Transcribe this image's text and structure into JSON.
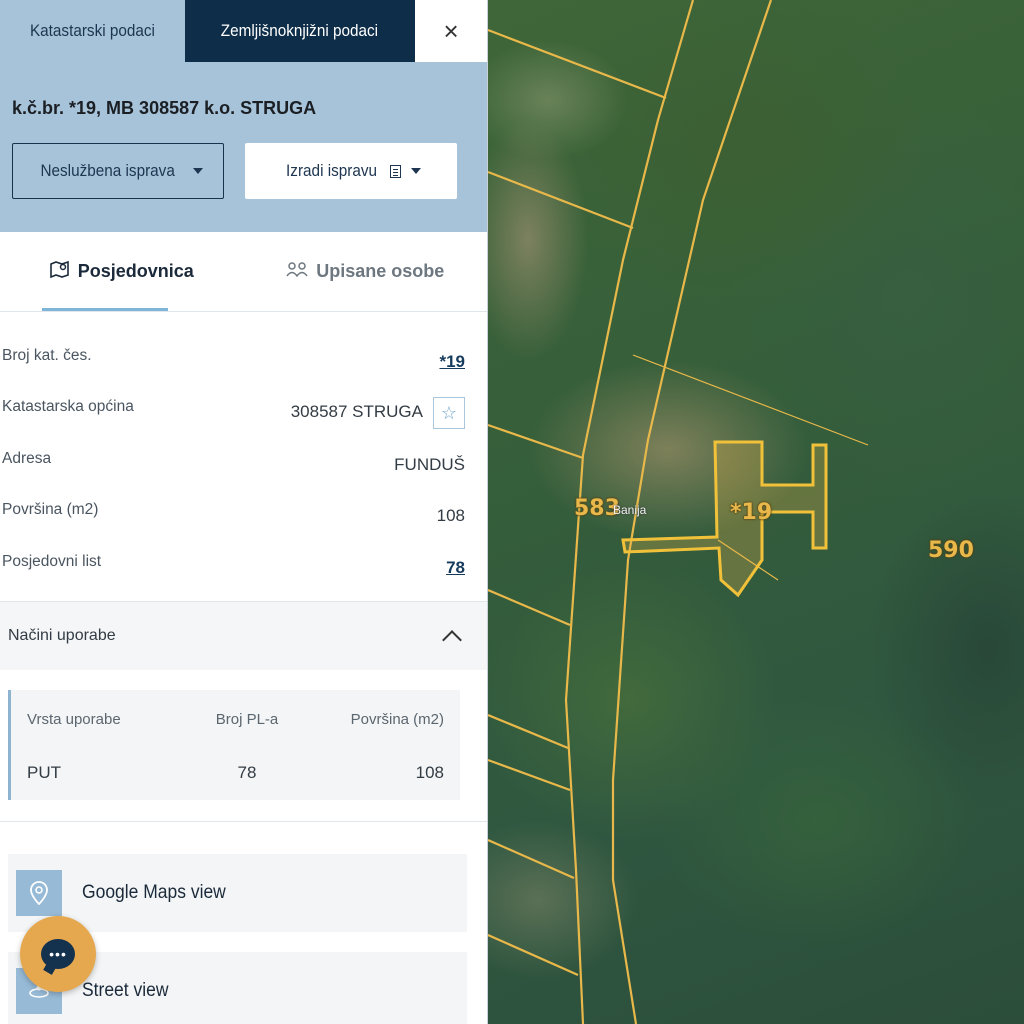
{
  "top_tabs": {
    "cadastral_label": "Katastarski podaci",
    "land_registry_label": "Zemljišnoknjižni podaci",
    "close_label": "×"
  },
  "header": {
    "title": "k.č.br. *19, MB 308587 k.o. STRUGA",
    "unofficial_doc_label": "Neslužbena isprava",
    "create_doc_label": "Izradi ispravu"
  },
  "subtabs": {
    "possession_label": "Posjedovnica",
    "persons_label": "Upisane osobe"
  },
  "details": {
    "parcel_no_label": "Broj kat. čes.",
    "parcel_no_value": "*19",
    "municipality_label": "Katastarska općina",
    "municipality_value": "308587 STRUGA",
    "address_label": "Adresa",
    "address_value": "FUNDUŠ",
    "area_label": "Površina (m2)",
    "area_value": "108",
    "possession_sheet_label": "Posjedovni list",
    "possession_sheet_value": "78"
  },
  "uses": {
    "section_title": "Načini uporabe",
    "columns": [
      "Vrsta uporabe",
      "Broj PL-a",
      "Površina (m2)"
    ],
    "rows": [
      [
        "PUT",
        "78",
        "108"
      ]
    ]
  },
  "links": {
    "google_maps_label": "Google Maps view",
    "street_view_label": "Street view"
  },
  "map": {
    "parcel_label": "*19",
    "neighbor_label_left": "583",
    "neighbor_label_right": "590",
    "place_label": "Banija",
    "line_color": "#e8b84a"
  },
  "colors": {
    "panel_header": "#a7c3d9",
    "dark_tab": "#0e2d48",
    "chat_button": "#e6a84f"
  }
}
